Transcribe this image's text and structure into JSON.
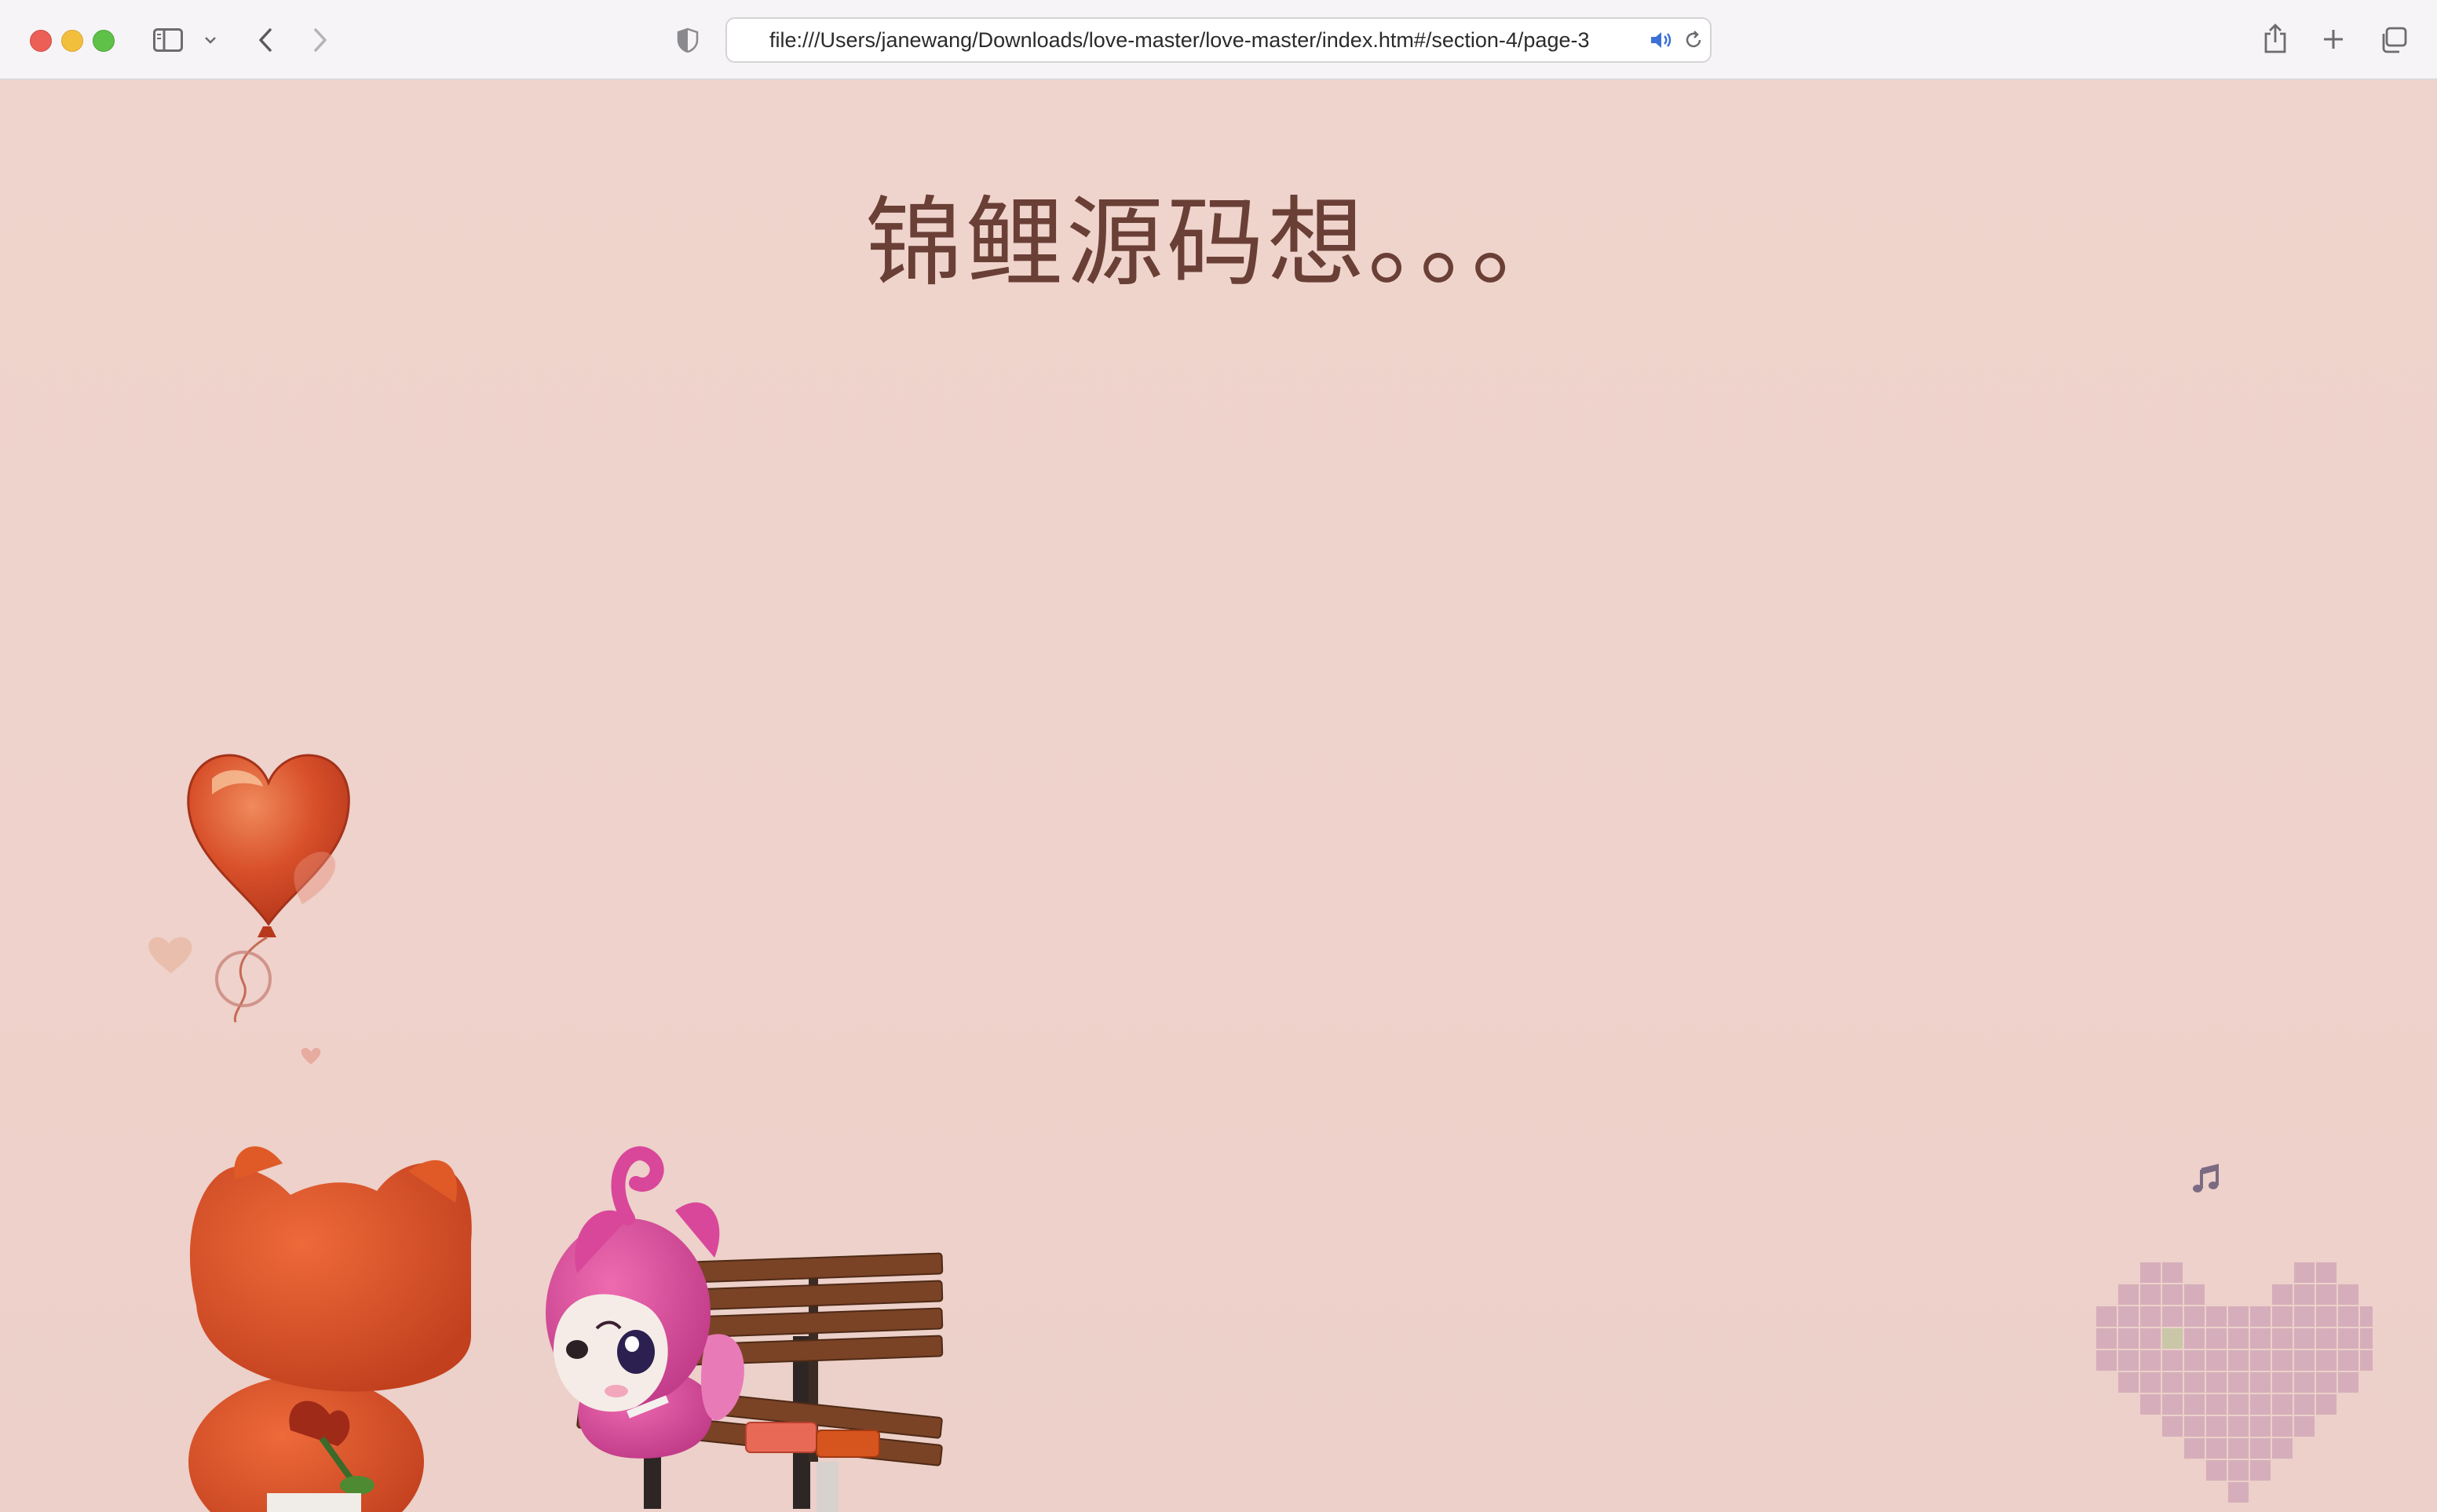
{
  "browser": {
    "url": "file:///Users/janewang/Downloads/love-master/love-master/index.htm#/section-4/page-3",
    "icons": [
      "sidebar-icon",
      "chevron-down-icon",
      "back-icon",
      "forward-icon",
      "privacy-shield-icon",
      "speaker-icon",
      "reload-icon",
      "share-icon",
      "new-tab-icon",
      "tab-overview-icon"
    ]
  },
  "page": {
    "headline": "锦鲤源码想。。。",
    "background_color": "#efd3cc",
    "headline_color": "#6a3f36",
    "music_icon": "music-note-icon",
    "illustration": "heart-balloon-foxes-on-bench",
    "pixel_heart_color": "#d6aebb",
    "pixel_heart_highlight": "#c9c7a8"
  }
}
